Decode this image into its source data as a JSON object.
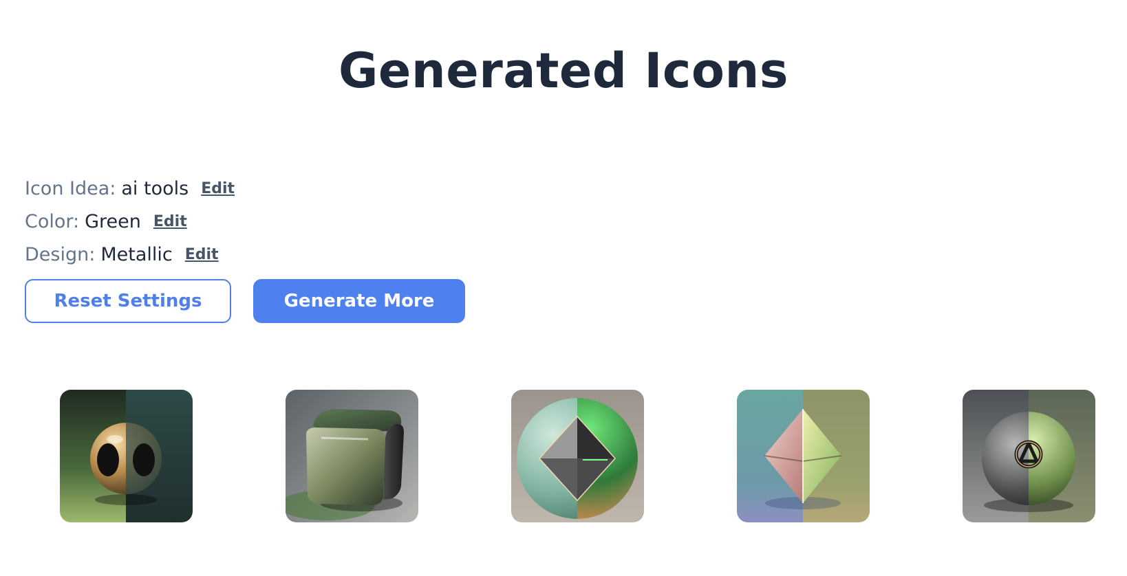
{
  "header": {
    "title": "Generated Icons"
  },
  "settings": [
    {
      "label": "Icon Idea:",
      "value": "ai tools",
      "edit_label": "Edit"
    },
    {
      "label": "Color:",
      "value": "Green",
      "edit_label": "Edit"
    },
    {
      "label": "Design:",
      "value": "Metallic",
      "edit_label": "Edit"
    }
  ],
  "actions": {
    "reset_label": "Reset Settings",
    "generate_label": "Generate More"
  },
  "colors": {
    "accent": "#4f81ee",
    "title": "#1e293b",
    "label": "#64748b"
  },
  "icons": [
    {
      "name": "metallic-orb-icon"
    },
    {
      "name": "metallic-cube-icon"
    },
    {
      "name": "metallic-sphere-diamond-icon"
    },
    {
      "name": "metallic-octahedron-icon"
    },
    {
      "name": "metallic-emblem-ball-icon"
    }
  ]
}
